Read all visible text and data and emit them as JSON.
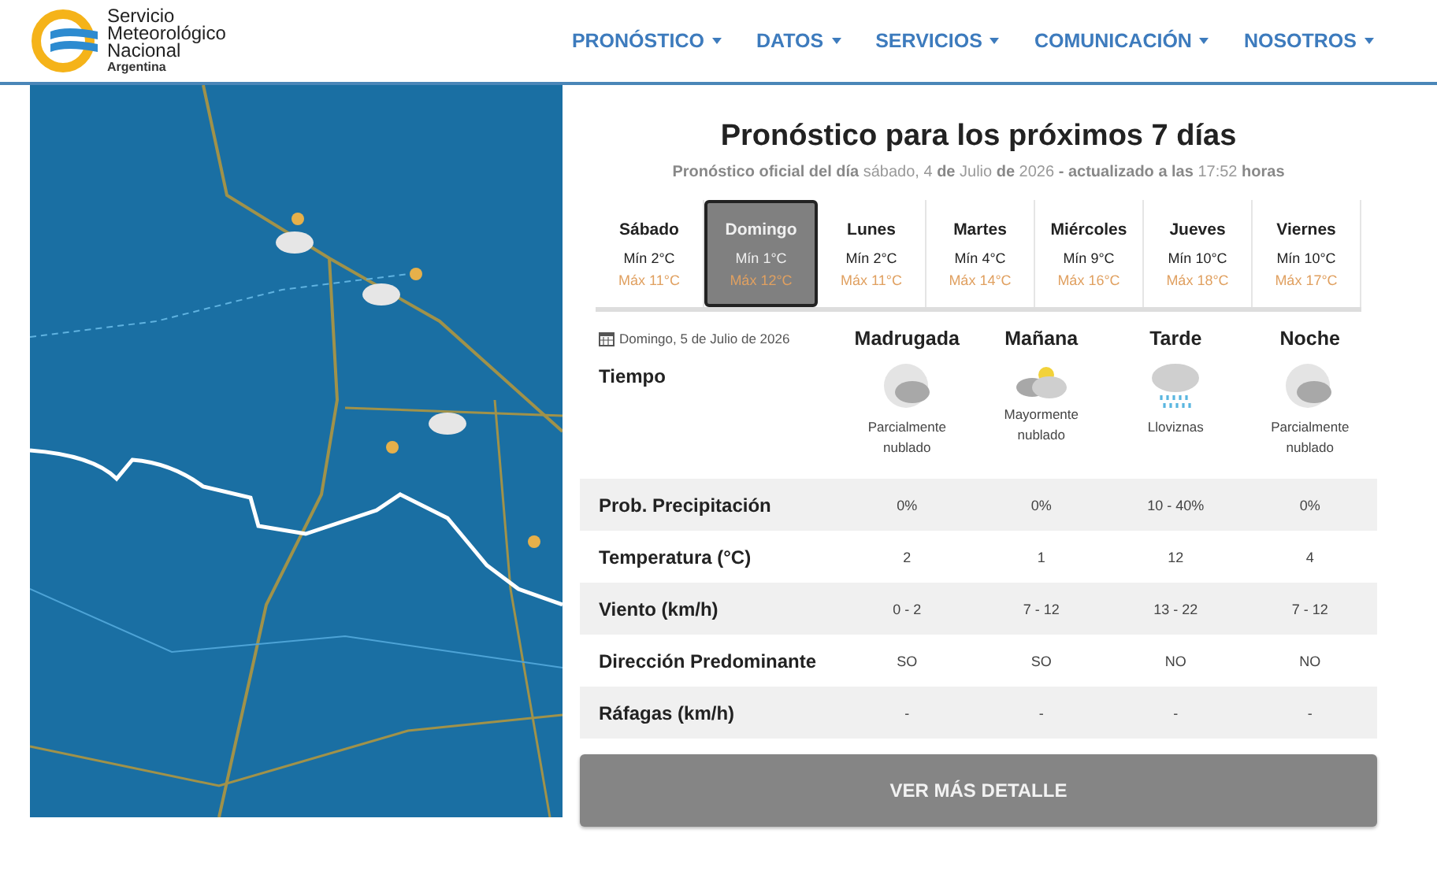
{
  "header": {
    "logo_lines": [
      "Servicio",
      "Meteorológico",
      "Nacional",
      "Argentina"
    ],
    "nav": [
      {
        "label": "PRONÓSTICO"
      },
      {
        "label": "DATOS"
      },
      {
        "label": "SERVICIOS"
      },
      {
        "label": "COMUNICACIÓN"
      },
      {
        "label": "NOSOTROS"
      }
    ]
  },
  "forecast": {
    "title": "Pronóstico para los próximos 7 días",
    "subtitle": "**Pronóstico oficial del día** sábado, 4 **de** Julio **de** 2026 **- actualizado a las** 17:52 **horas**",
    "days": [
      {
        "name": "Sábado",
        "min": "Mín 2°C",
        "max": "Máx 11°C",
        "selected": false
      },
      {
        "name": "Domingo",
        "min": "Mín 1°C",
        "max": "Máx 12°C",
        "selected": true
      },
      {
        "name": "Lunes",
        "min": "Mín 2°C",
        "max": "Máx 11°C",
        "selected": false
      },
      {
        "name": "Martes",
        "min": "Mín 4°C",
        "max": "Máx 14°C",
        "selected": false
      },
      {
        "name": "Miércoles",
        "min": "Mín 9°C",
        "max": "Máx 16°C",
        "selected": false
      },
      {
        "name": "Jueves",
        "min": "Mín 10°C",
        "max": "Máx 18°C",
        "selected": false
      },
      {
        "name": "Viernes",
        "min": "Mín 10°C",
        "max": "Máx 17°C",
        "selected": false
      }
    ],
    "date": "Domingo, 5 de Julio de 2026",
    "weather_label": "Tiempo",
    "periods": [
      {
        "name": "Madrugada",
        "kind": "night-cloud",
        "condition": "Parcialmente nublado"
      },
      {
        "name": "Mañana",
        "kind": "sun-cloud",
        "condition": "Mayormente nublado"
      },
      {
        "name": "Tarde",
        "kind": "drizzle",
        "condition": "Lloviznas"
      },
      {
        "name": "Noche",
        "kind": "night-cloud",
        "condition": "Parcialmente nublado"
      }
    ],
    "rows": [
      {
        "label": "Prob. Precipitación",
        "values": [
          "0%",
          "0%",
          "10 - 40%",
          "0%"
        ]
      },
      {
        "label": "Temperatura (°C)",
        "values": [
          "2",
          "1",
          "12",
          "4"
        ]
      },
      {
        "label": "Viento (km/h)",
        "values": [
          "0 - 2",
          "7 - 12",
          "13 - 22",
          "7 - 12"
        ]
      },
      {
        "label": "Dirección Predominante",
        "values": [
          "SO",
          "SO",
          "NO",
          "NO"
        ]
      },
      {
        "label": "Ráfagas (km/h)",
        "values": [
          "-",
          "-",
          "-",
          "-"
        ]
      }
    ],
    "button": "VER MÁS DETALLE"
  }
}
